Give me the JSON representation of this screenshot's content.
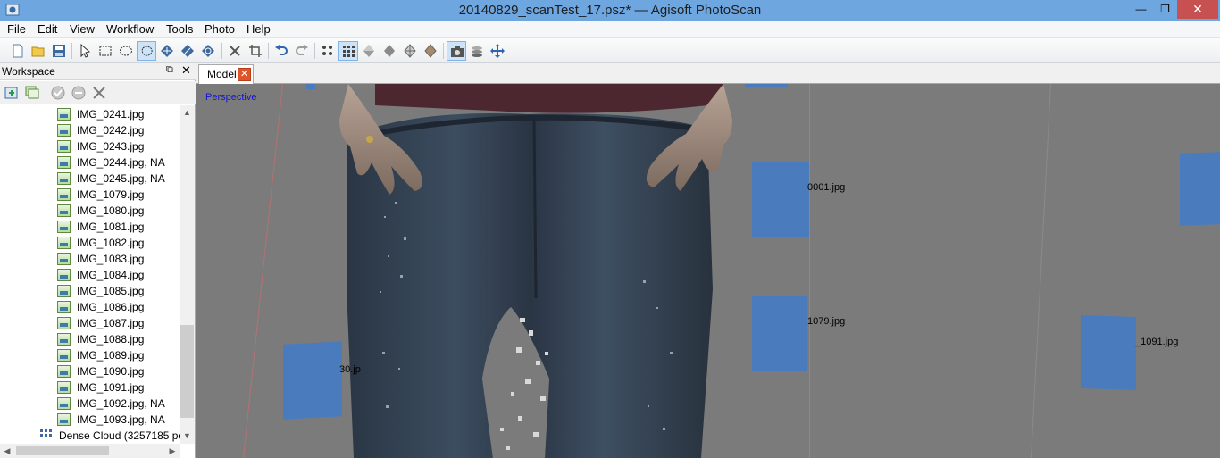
{
  "window": {
    "title": "20140829_scanTest_17.psz* — Agisoft PhotoScan",
    "minimize": "—",
    "maximize": "❐",
    "close": "✕"
  },
  "menu": [
    "File",
    "Edit",
    "View",
    "Workflow",
    "Tools",
    "Photo",
    "Help"
  ],
  "toolbar": {
    "icons": [
      "new-icon",
      "open-icon",
      "save-icon",
      "pointer-icon",
      "rect-select-icon",
      "circle-select-icon",
      "free-select-icon",
      "move-region-icon",
      "resize-region-icon",
      "rotate-region-icon",
      "delete-icon",
      "crop-icon",
      "undo-icon",
      "redo-icon",
      "show-points-icon",
      "dense-cloud-icon",
      "shaded-icon",
      "solid-icon",
      "wireframe-icon",
      "textured-icon",
      "show-cameras-icon",
      "show-region-icon",
      "navigation-icon"
    ],
    "active": [
      "circle-select-icon",
      "dense-cloud-icon",
      "show-cameras-icon"
    ]
  },
  "workspace": {
    "title": "Workspace",
    "float": "⧉",
    "close": "✕",
    "items": [
      "IMG_0241.jpg",
      "IMG_0242.jpg",
      "IMG_0243.jpg",
      "IMG_0244.jpg, NA",
      "IMG_0245.jpg, NA",
      "IMG_1079.jpg",
      "IMG_1080.jpg",
      "IMG_1081.jpg",
      "IMG_1082.jpg",
      "IMG_1083.jpg",
      "IMG_1084.jpg",
      "IMG_1085.jpg",
      "IMG_1086.jpg",
      "IMG_1087.jpg",
      "IMG_1088.jpg",
      "IMG_1089.jpg",
      "IMG_1090.jpg",
      "IMG_1091.jpg",
      "IMG_1092.jpg, NA",
      "IMG_1093.jpg, NA"
    ],
    "dense_cloud": "Dense Cloud (3257185 po",
    "scroll_up": "▲",
    "scroll_down": "▼",
    "scroll_left": "◀",
    "scroll_right": "▶"
  },
  "model_tab": {
    "label": "Model",
    "close": "✕"
  },
  "viewport": {
    "projection": "Perspective",
    "camera_labels": [
      "0001.jpg",
      "1079.jpg",
      "_1091.jpg",
      "30.jp"
    ]
  },
  "colors": {
    "titlebar": "#6ea6e0",
    "camera": "#4a7cbd",
    "viewport_bg": "#7b7b7b",
    "close": "#c75050"
  }
}
